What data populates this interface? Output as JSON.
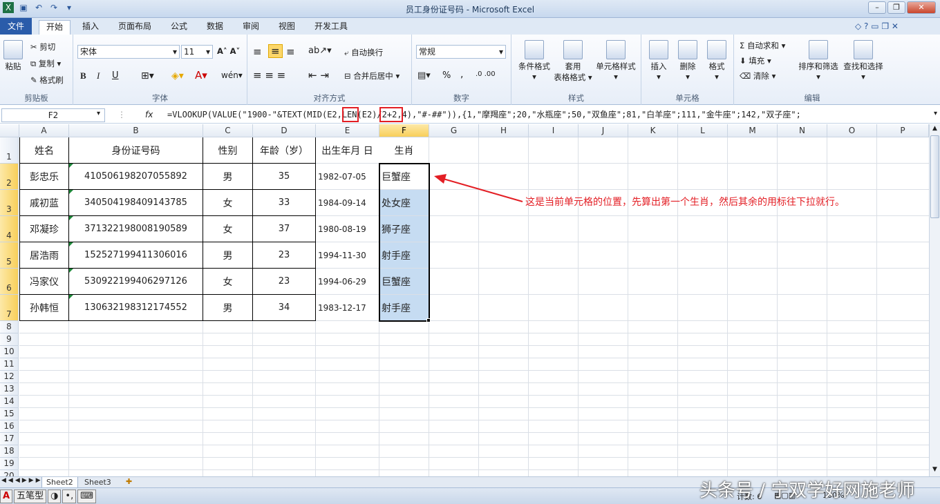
{
  "window": {
    "title": "员工身份证号码 - Microsoft Excel"
  },
  "tabs": [
    "文件",
    "开始",
    "插入",
    "页面布局",
    "公式",
    "数据",
    "审阅",
    "视图",
    "开发工具"
  ],
  "ribbon": {
    "clipboard": {
      "label": "剪贴板",
      "paste": "粘贴",
      "cut": "剪切",
      "copy": "复制",
      "format_painter": "格式刷"
    },
    "font": {
      "label": "字体",
      "name": "宋体",
      "size": "11",
      "bold": "B",
      "italic": "I",
      "underline": "U"
    },
    "align": {
      "label": "对齐方式",
      "wrap": "自动换行",
      "merge": "合并后居中"
    },
    "number": {
      "label": "数字",
      "format": "常规",
      "percent": "%",
      "comma": ","
    },
    "styles": {
      "label": "样式",
      "cond": "条件格式",
      "table": "套用",
      "table2": "表格格式",
      "cellstyle": "单元格样式"
    },
    "cells": {
      "label": "单元格",
      "insert": "插入",
      "delete": "删除",
      "format": "格式"
    },
    "edit": {
      "label": "编辑",
      "autosum": "自动求和",
      "fill": "填充",
      "clear": "清除",
      "sort": "排序和筛选",
      "find": "查找和选择"
    }
  },
  "formula_bar": {
    "name_box": "F2",
    "fx": "fx",
    "formula": "=VLOOKUP(VALUE(\"1900-\"&TEXT(MID(E2,LEN(E2)/2+2,4),\"#-##\")),{1,\"摩羯座\";20,\"水瓶座\";50,\"双鱼座\";81,\"白羊座\";111,\"金牛座\";142,\"双子座\";"
  },
  "columns": [
    "A",
    "B",
    "C",
    "D",
    "E",
    "F",
    "G",
    "H",
    "I",
    "J",
    "K",
    "L",
    "M",
    "N",
    "O",
    "P"
  ],
  "rows": [
    "1",
    "2",
    "3",
    "4",
    "5",
    "6",
    "7",
    "8",
    "9",
    "10",
    "11",
    "12",
    "13",
    "14",
    "15",
    "16",
    "17",
    "18",
    "19",
    "20"
  ],
  "table": {
    "headers": [
      "姓名",
      "身份证号码",
      "性别",
      "年龄（岁）",
      "出生年月 日",
      "生肖"
    ],
    "rows": [
      [
        "彭忠乐",
        "410506198207055892",
        "男",
        "35",
        "1982-07-05",
        "巨蟹座"
      ],
      [
        "戚初蓝",
        "340504198409143785",
        "女",
        "33",
        "1984-09-14",
        "处女座"
      ],
      [
        "邓凝珍",
        "371322198008190589",
        "女",
        "37",
        "1980-08-19",
        "狮子座"
      ],
      [
        "居浩雨",
        "152527199411306016",
        "男",
        "23",
        "1994-11-30",
        "射手座"
      ],
      [
        "冯家仪",
        "530922199406297126",
        "女",
        "23",
        "1994-06-29",
        "巨蟹座"
      ],
      [
        "孙韩恒",
        "130632198312174552",
        "男",
        "34",
        "1983-12-17",
        "射手座"
      ]
    ]
  },
  "annotation": "这是当前单元格的位置，先算出第一个生肖，然后其余的用标往下拉就行。",
  "sheets": [
    "Sheet2",
    "Sheet3"
  ],
  "status": {
    "ime": [
      "A",
      "五笔型"
    ],
    "count": "计数: 6",
    "zoom": "100%"
  },
  "watermark": "头条号 / 宁双学好网施老师",
  "colors": {
    "accent": "#2a5caa",
    "highlight": "#e31e24",
    "selection": "#c6dcf2"
  }
}
